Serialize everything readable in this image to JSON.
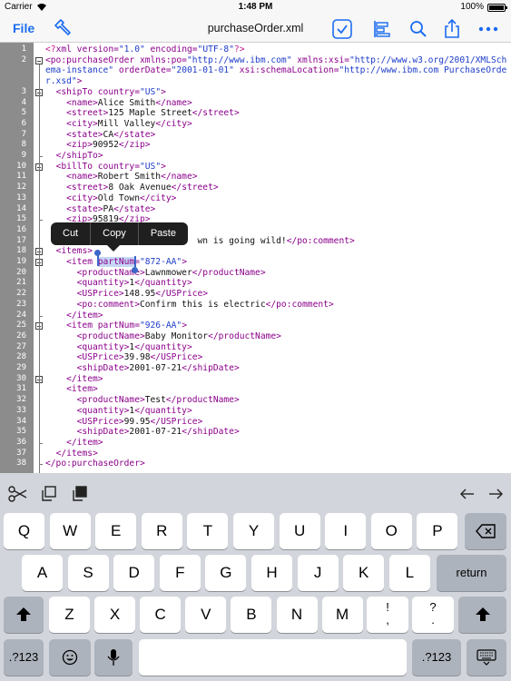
{
  "status": {
    "carrier": "Carrier",
    "time": "1:48 PM",
    "battery": "100%"
  },
  "nav": {
    "file": "File",
    "title": "purchaseOrder.xml"
  },
  "context_menu": {
    "cut": "Cut",
    "copy": "Copy",
    "paste": "Paste"
  },
  "lines": [
    {
      "n": "1",
      "code": [
        [
          "pi",
          "<?"
        ],
        [
          "tag",
          "xml "
        ],
        [
          "attr",
          "version="
        ],
        [
          "val",
          "\"1.0\""
        ],
        [
          "attr",
          " encoding="
        ],
        [
          "val",
          "\"UTF-8\""
        ],
        [
          "pi",
          "?>"
        ]
      ]
    },
    {
      "n": "2",
      "code": [
        [
          "tag",
          "<po:purchaseOrder "
        ],
        [
          "attr",
          "xmlns:po="
        ],
        [
          "val",
          "\"http://www.ibm.com\""
        ],
        [
          "attr",
          " xmlns:xsi="
        ],
        [
          "val",
          "\"http://www.w3.org/2001/XMLSch"
        ]
      ]
    },
    {
      "n": "",
      "code": [
        [
          "val",
          "ema-instance\""
        ],
        [
          "attr",
          " orderDate="
        ],
        [
          "val",
          "\"2001-01-01\""
        ],
        [
          "attr",
          " xsi:schemaLocation="
        ],
        [
          "val",
          "\"http://www.ibm.com PurchaseOrde"
        ]
      ]
    },
    {
      "n": "",
      "code": [
        [
          "val",
          "r.xsd\""
        ],
        [
          "tag",
          ">"
        ]
      ]
    },
    {
      "n": "3",
      "code": [
        [
          "txt",
          "  "
        ],
        [
          "tag",
          "<shipTo "
        ],
        [
          "attr",
          "country="
        ],
        [
          "val",
          "\"US\""
        ],
        [
          "tag",
          ">"
        ]
      ]
    },
    {
      "n": "4",
      "code": [
        [
          "txt",
          "    "
        ],
        [
          "tag",
          "<name>"
        ],
        [
          "txt",
          "Alice Smith"
        ],
        [
          "tag",
          "</name>"
        ]
      ]
    },
    {
      "n": "5",
      "code": [
        [
          "txt",
          "    "
        ],
        [
          "tag",
          "<street>"
        ],
        [
          "txt",
          "125 Maple Street"
        ],
        [
          "tag",
          "</street>"
        ]
      ]
    },
    {
      "n": "6",
      "code": [
        [
          "txt",
          "    "
        ],
        [
          "tag",
          "<city>"
        ],
        [
          "txt",
          "Mill Valley"
        ],
        [
          "tag",
          "</city>"
        ]
      ]
    },
    {
      "n": "7",
      "code": [
        [
          "txt",
          "    "
        ],
        [
          "tag",
          "<state>"
        ],
        [
          "txt",
          "CA"
        ],
        [
          "tag",
          "</state>"
        ]
      ]
    },
    {
      "n": "8",
      "code": [
        [
          "txt",
          "    "
        ],
        [
          "tag",
          "<zip>"
        ],
        [
          "txt",
          "90952"
        ],
        [
          "tag",
          "</zip>"
        ]
      ]
    },
    {
      "n": "9",
      "code": [
        [
          "txt",
          "  "
        ],
        [
          "tag",
          "</shipTo>"
        ]
      ]
    },
    {
      "n": "10",
      "code": [
        [
          "txt",
          "  "
        ],
        [
          "tag",
          "<billTo "
        ],
        [
          "attr",
          "country="
        ],
        [
          "val",
          "\"US\""
        ],
        [
          "tag",
          ">"
        ]
      ]
    },
    {
      "n": "11",
      "code": [
        [
          "txt",
          "    "
        ],
        [
          "tag",
          "<name>"
        ],
        [
          "txt",
          "Robert Smith"
        ],
        [
          "tag",
          "</name>"
        ]
      ]
    },
    {
      "n": "12",
      "code": [
        [
          "txt",
          "    "
        ],
        [
          "tag",
          "<street>"
        ],
        [
          "txt",
          "8 Oak Avenue"
        ],
        [
          "tag",
          "</street>"
        ]
      ]
    },
    {
      "n": "13",
      "code": [
        [
          "txt",
          "    "
        ],
        [
          "tag",
          "<city>"
        ],
        [
          "txt",
          "Old Town"
        ],
        [
          "tag",
          "</city>"
        ]
      ]
    },
    {
      "n": "14",
      "code": [
        [
          "txt",
          "    "
        ],
        [
          "tag",
          "<state>"
        ],
        [
          "txt",
          "PA"
        ],
        [
          "tag",
          "</state>"
        ]
      ]
    },
    {
      "n": "15",
      "code": [
        [
          "txt",
          "    "
        ],
        [
          "tag",
          "<zip>"
        ],
        [
          "txt",
          "95819"
        ],
        [
          "tag",
          "</zip>"
        ]
      ]
    },
    {
      "n": "16",
      "code": [
        [
          "txt",
          ""
        ]
      ]
    },
    {
      "n": "17",
      "code": [
        [
          "txt",
          "                             wn is going wild!"
        ],
        [
          "tag",
          "</po:comment>"
        ]
      ]
    },
    {
      "n": "18",
      "code": [
        [
          "txt",
          "  "
        ],
        [
          "tag",
          "<items>"
        ]
      ]
    },
    {
      "n": "19",
      "code": [
        [
          "txt",
          "    "
        ],
        [
          "tag",
          "<item "
        ],
        [
          "sel",
          "partNum"
        ],
        [
          "attr",
          "="
        ],
        [
          "val",
          "\"872-AA\""
        ],
        [
          "tag",
          ">"
        ]
      ]
    },
    {
      "n": "20",
      "code": [
        [
          "txt",
          "      "
        ],
        [
          "tag",
          "<productName>"
        ],
        [
          "txt",
          "Lawnmower"
        ],
        [
          "tag",
          "</productName>"
        ]
      ]
    },
    {
      "n": "21",
      "code": [
        [
          "txt",
          "      "
        ],
        [
          "tag",
          "<quantity>"
        ],
        [
          "txt",
          "1"
        ],
        [
          "tag",
          "</quantity>"
        ]
      ]
    },
    {
      "n": "22",
      "code": [
        [
          "txt",
          "      "
        ],
        [
          "tag",
          "<USPrice>"
        ],
        [
          "txt",
          "148.95"
        ],
        [
          "tag",
          "</USPrice>"
        ]
      ]
    },
    {
      "n": "23",
      "code": [
        [
          "txt",
          "      "
        ],
        [
          "tag",
          "<po:comment>"
        ],
        [
          "txt",
          "Confirm this is electric"
        ],
        [
          "tag",
          "</po:comment>"
        ]
      ]
    },
    {
      "n": "24",
      "code": [
        [
          "txt",
          "    "
        ],
        [
          "tag",
          "</item>"
        ]
      ]
    },
    {
      "n": "25",
      "code": [
        [
          "txt",
          "    "
        ],
        [
          "tag",
          "<item "
        ],
        [
          "attr",
          "partNum="
        ],
        [
          "val",
          "\"926-AA\""
        ],
        [
          "tag",
          ">"
        ]
      ]
    },
    {
      "n": "26",
      "code": [
        [
          "txt",
          "      "
        ],
        [
          "tag",
          "<productName>"
        ],
        [
          "txt",
          "Baby Monitor"
        ],
        [
          "tag",
          "</productName>"
        ]
      ]
    },
    {
      "n": "27",
      "code": [
        [
          "txt",
          "      "
        ],
        [
          "tag",
          "<quantity>"
        ],
        [
          "txt",
          "1"
        ],
        [
          "tag",
          "</quantity>"
        ]
      ]
    },
    {
      "n": "28",
      "code": [
        [
          "txt",
          "      "
        ],
        [
          "tag",
          "<USPrice>"
        ],
        [
          "txt",
          "39.98"
        ],
        [
          "tag",
          "</USPrice>"
        ]
      ]
    },
    {
      "n": "29",
      "code": [
        [
          "txt",
          "      "
        ],
        [
          "tag",
          "<shipDate>"
        ],
        [
          "txt",
          "2001-07-21"
        ],
        [
          "tag",
          "</shipDate>"
        ]
      ]
    },
    {
      "n": "30",
      "code": [
        [
          "txt",
          "    "
        ],
        [
          "tag",
          "</item>"
        ]
      ]
    },
    {
      "n": "31",
      "code": [
        [
          "txt",
          "    "
        ],
        [
          "tag",
          "<item>"
        ]
      ]
    },
    {
      "n": "32",
      "code": [
        [
          "txt",
          "      "
        ],
        [
          "tag",
          "<productName>"
        ],
        [
          "txt",
          "Test"
        ],
        [
          "tag",
          "</productName>"
        ]
      ]
    },
    {
      "n": "33",
      "code": [
        [
          "txt",
          "      "
        ],
        [
          "tag",
          "<quantity>"
        ],
        [
          "txt",
          "1"
        ],
        [
          "tag",
          "</quantity>"
        ]
      ]
    },
    {
      "n": "34",
      "code": [
        [
          "txt",
          "      "
        ],
        [
          "tag",
          "<USPrice>"
        ],
        [
          "txt",
          "99.95"
        ],
        [
          "tag",
          "</USPrice>"
        ]
      ]
    },
    {
      "n": "35",
      "code": [
        [
          "txt",
          "      "
        ],
        [
          "tag",
          "<shipDate>"
        ],
        [
          "txt",
          "2001-07-21"
        ],
        [
          "tag",
          "</shipDate>"
        ]
      ]
    },
    {
      "n": "36",
      "code": [
        [
          "txt",
          "    "
        ],
        [
          "tag",
          "</item>"
        ]
      ]
    },
    {
      "n": "37",
      "code": [
        [
          "txt",
          "  "
        ],
        [
          "tag",
          "</items>"
        ]
      ]
    },
    {
      "n": "38",
      "code": [
        [
          "tag",
          "</po:purchaseOrder>"
        ]
      ]
    }
  ],
  "keyboard": {
    "row1": [
      "Q",
      "W",
      "E",
      "R",
      "T",
      "Y",
      "U",
      "I",
      "O",
      "P"
    ],
    "row2": [
      "A",
      "S",
      "D",
      "F",
      "G",
      "H",
      "J",
      "K",
      "L"
    ],
    "row3": [
      "Z",
      "X",
      "C",
      "V",
      "B",
      "N",
      "M"
    ],
    "return": "return",
    "num_left": ".?123",
    "num_right": ".?123",
    "excl_top": "!",
    "excl_bottom": ",",
    "quest_top": "?",
    "quest_bottom": "."
  },
  "icons": {
    "build": "hammer-icon",
    "validate": "check-square-icon",
    "format": "align-icon",
    "search": "search-icon",
    "share": "share-icon",
    "more": "more-icon"
  },
  "colors": {
    "accent": "#1a6cf0",
    "gutter": "#8c8c8c",
    "tag": "#8b008b",
    "value": "#1d3cc9"
  }
}
